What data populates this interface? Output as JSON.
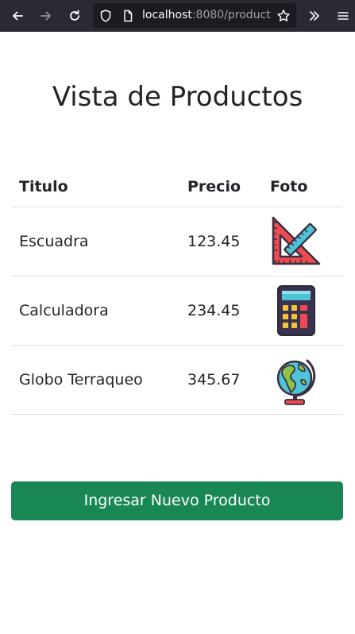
{
  "browser": {
    "url_host": "localhost",
    "url_rest": ":8080/product",
    "icons": [
      "back-icon",
      "forward-icon",
      "reload-icon",
      "shield-icon",
      "page-icon",
      "star-icon",
      "overflow-icon",
      "menu-icon"
    ]
  },
  "page": {
    "title": "Vista de Productos"
  },
  "table": {
    "headers": {
      "titulo": "Titulo",
      "precio": "Precio",
      "foto": "Foto"
    },
    "rows": [
      {
        "titulo": "Escuadra",
        "precio": "123.45",
        "foto_icon": "set-square-icon"
      },
      {
        "titulo": "Calculadora",
        "precio": "234.45",
        "foto_icon": "calculator-icon"
      },
      {
        "titulo": "Globo Terraqueo",
        "precio": "345.67",
        "foto_icon": "globe-icon"
      }
    ]
  },
  "actions": {
    "new_product_label": "Ingresar Nuevo Producto",
    "new_product_color": "#198754"
  }
}
